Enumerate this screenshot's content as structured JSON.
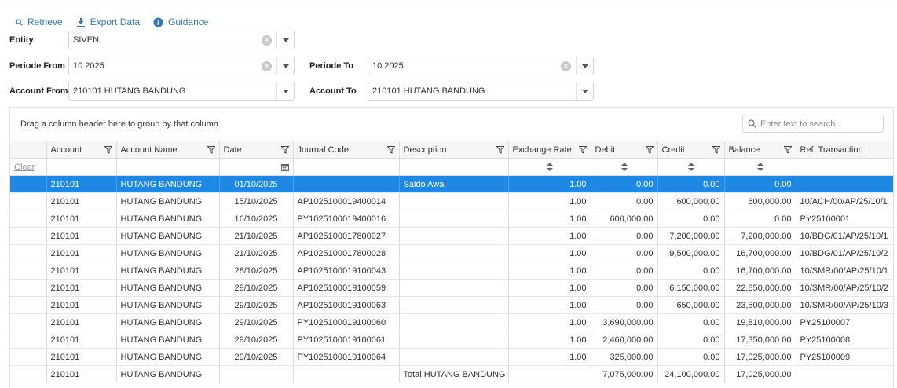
{
  "toolbar": {
    "retrieve": "Retrieve",
    "export": "Export Data",
    "guidance": "Guidance",
    "accent": "#337ab7"
  },
  "filters": {
    "entity": {
      "label": "Entity",
      "value": "SIVEN"
    },
    "periode_from": {
      "label": "Periode From",
      "value": "10 2025"
    },
    "periode_to": {
      "label": "Periode To",
      "value": "10 2025"
    },
    "account_from": {
      "label": "Account From",
      "value": "210101 HUTANG BANDUNG"
    },
    "account_to": {
      "label": "Account To",
      "value": "210101 HUTANG BANDUNG"
    }
  },
  "grid": {
    "group_panel": "Drag a column header here to group by that column",
    "search_placeholder": "Enter text to search...",
    "clear": "Clear",
    "selected_color": "#1e88e5",
    "columns": [
      "Account",
      "Account Name",
      "Date",
      "Journal Code",
      "Description",
      "Exchange Rate",
      "Debit",
      "Credit",
      "Balance",
      "Ref. Transaction"
    ],
    "rows": [
      [
        "210101",
        "HUTANG BANDUNG",
        "01/10/2025",
        "",
        "Saldo Awal",
        "1.00",
        "0.00",
        "0.00",
        "0.00",
        ""
      ],
      [
        "210101",
        "HUTANG BANDUNG",
        "15/10/2025",
        "AP1025100019400014",
        "",
        "1.00",
        "0.00",
        "600,000.00",
        "600,000.00",
        "10/ACH/00/AP/25/10/1"
      ],
      [
        "210101",
        "HUTANG BANDUNG",
        "16/10/2025",
        "PY1025100019400016",
        "",
        "1.00",
        "600,000.00",
        "0.00",
        "0.00",
        "PY25100001"
      ],
      [
        "210101",
        "HUTANG BANDUNG",
        "21/10/2025",
        "AP1025100017800027",
        "",
        "1.00",
        "0.00",
        "7,200,000.00",
        "7,200,000.00",
        "10/BDG/01/AP/25/10/1"
      ],
      [
        "210101",
        "HUTANG BANDUNG",
        "21/10/2025",
        "AP1025100017800028",
        "",
        "1.00",
        "0.00",
        "9,500,000.00",
        "16,700,000.00",
        "10/BDG/01/AP/25/10/2"
      ],
      [
        "210101",
        "HUTANG BANDUNG",
        "28/10/2025",
        "AP1025100019100043",
        "",
        "1.00",
        "0.00",
        "0.00",
        "16,700,000.00",
        "10/SMR/00/AP/25/10/1"
      ],
      [
        "210101",
        "HUTANG BANDUNG",
        "29/10/2025",
        "AP1025100019100059",
        "",
        "1.00",
        "0.00",
        "6,150,000.00",
        "22,850,000.00",
        "10/SMR/00/AP/25/10/2"
      ],
      [
        "210101",
        "HUTANG BANDUNG",
        "29/10/2025",
        "AP1025100019100063",
        "",
        "1.00",
        "0.00",
        "650,000.00",
        "23,500,000.00",
        "10/SMR/00/AP/25/10/3"
      ],
      [
        "210101",
        "HUTANG BANDUNG",
        "29/10/2025",
        "PY1025100019100060",
        "",
        "1.00",
        "3,690,000.00",
        "0.00",
        "19,810,000.00",
        "PY25100007"
      ],
      [
        "210101",
        "HUTANG BANDUNG",
        "29/10/2025",
        "PY1025100019100061",
        "",
        "1.00",
        "2,460,000.00",
        "0.00",
        "17,350,000.00",
        "PY25100008"
      ],
      [
        "210101",
        "HUTANG BANDUNG",
        "29/10/2025",
        "PY1025100019100064",
        "",
        "1.00",
        "325,000.00",
        "0.00",
        "17,025,000.00",
        "PY25100009"
      ],
      [
        "210101",
        "HUTANG BANDUNG",
        "",
        "",
        "Total HUTANG BANDUNG",
        "",
        "7,075,000.00",
        "24,100,000.00",
        "17,025,000.00",
        ""
      ]
    ]
  }
}
